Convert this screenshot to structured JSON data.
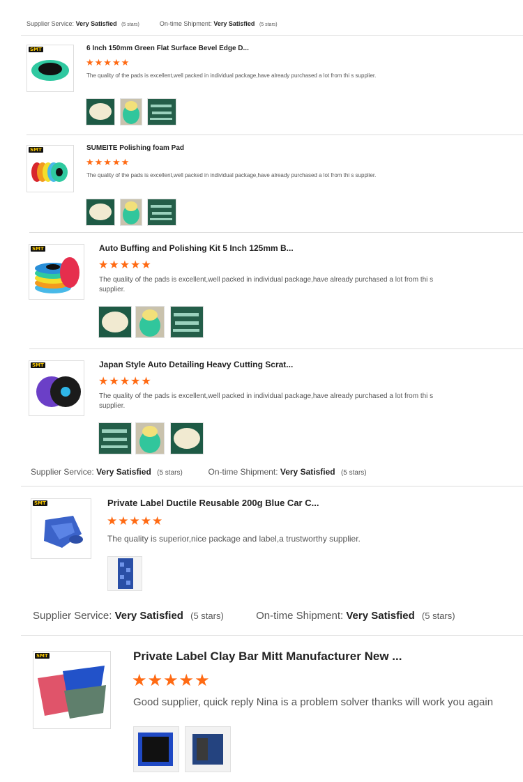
{
  "labels": {
    "supplier_service": "Supplier Service:",
    "ontime_shipment": "On-time Shipment:",
    "very_satisfied": "Very Satisfied",
    "five_stars": "(5 stars)",
    "star_glyphs": "★★★★★"
  },
  "reviews": [
    {
      "title": "6 Inch 150mm Green Flat Surface Bevel Edge D...",
      "comment": "The quality of the pads is excellent,well packed in individual package,have already purchased a lot from thi s supplier.",
      "rating": 5
    },
    {
      "title": "SUMEITE Polishing foam Pad",
      "comment": "The quality of the pads is excellent,well packed in individual package,have already purchased a lot from thi s supplier.",
      "rating": 5
    },
    {
      "title": "Auto Buffing and Polishing Kit 5 Inch 125mm B...",
      "comment": "The quality of the pads is excellent,well packed in individual package,have already purchased a lot from thi s supplier.",
      "rating": 5
    },
    {
      "title": "Japan Style Auto Detailing Heavy Cutting Scrat...",
      "comment": "The quality of the pads is excellent,well packed in individual package,have already purchased a lot from thi s supplier.",
      "rating": 5
    },
    {
      "title": "Private Label Ductile Reusable 200g Blue Car C...",
      "comment": "The quality is superior,nice package and label,a trustworthy supplier.",
      "rating": 5
    },
    {
      "title": "Private Label Clay Bar Mitt Manufacturer New ...",
      "comment": "Good supplier, quick reply Nina is a problem solver thanks will work you again",
      "rating": 5
    }
  ],
  "colors": {
    "star": "#ff6a13",
    "divider": "#dcdcdc"
  }
}
